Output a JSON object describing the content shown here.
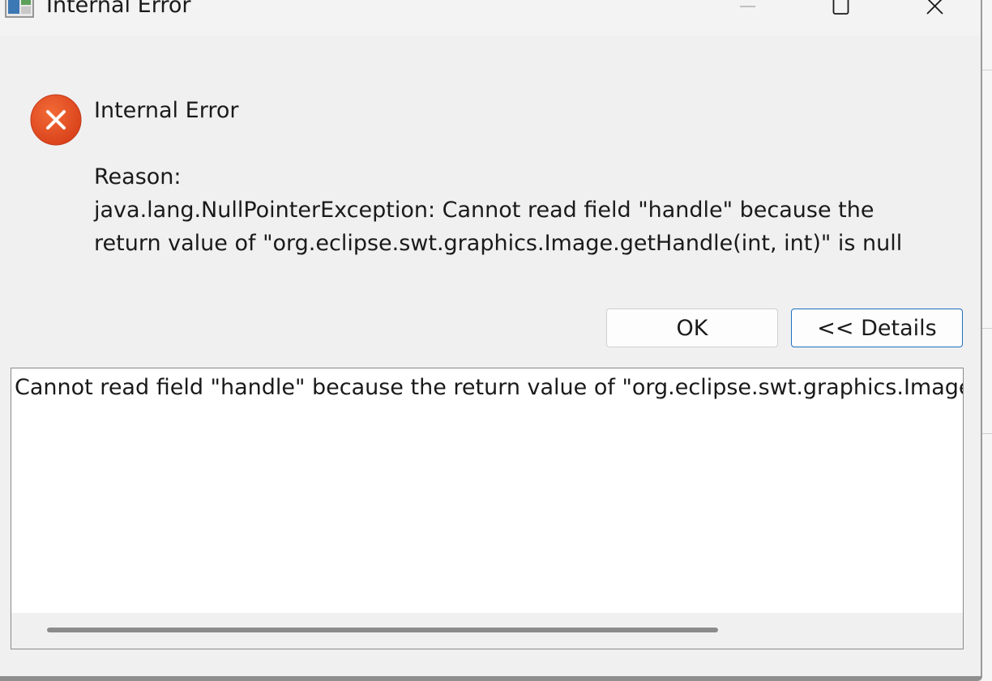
{
  "window": {
    "title": "Internal Error",
    "icon": "eclipse-app-icon",
    "controls": [
      "minimize-icon",
      "maximize-icon",
      "close-icon"
    ]
  },
  "message": {
    "icon": "error-icon",
    "heading": "Internal Error",
    "reason_label": "Reason:",
    "reason_line1": "java.lang.NullPointerException: Cannot read field \"handle\" because the",
    "reason_line2": "return value of \"org.eclipse.swt.graphics.Image.getHandle(int, int)\" is null"
  },
  "buttons": {
    "ok_label": "OK",
    "details_label": "<< Details"
  },
  "details": {
    "text": "Cannot read field \"handle\" because the return value of \"org.eclipse.swt.graphics.Image.getHandle(int, int)\" is null"
  },
  "colors": {
    "error_red": "#e8501f",
    "focus_border": "#1f6fbf",
    "background": "#f0f0f0"
  }
}
